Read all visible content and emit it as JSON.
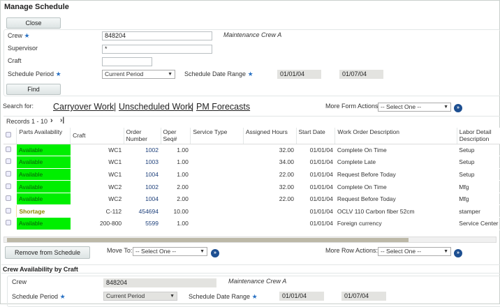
{
  "title": "Manage Schedule",
  "close_label": "Close",
  "find_label": "Find",
  "form": {
    "crew_label": "Crew",
    "crew_value": "848204",
    "crew_name": "Maintenance Crew A",
    "supervisor_label": "Supervisor",
    "supervisor_value": "*",
    "craft_label": "Craft",
    "craft_value": "",
    "period_label": "Schedule Period",
    "period_value": "Current Period",
    "range_label": "Schedule Date Range",
    "range_from": "01/01/04",
    "range_to": "01/07/04"
  },
  "search": {
    "label": "Search for:",
    "links": [
      "Carryover Work",
      "Unscheduled Work",
      "PM Forecasts"
    ],
    "sep": "|",
    "actions_label": "More Form Actions:",
    "actions_value": "-- Select One --"
  },
  "records": "Records 1 - 10",
  "columns": [
    "Parts Availability",
    "Craft",
    "Order Number",
    "Oper Seq#",
    "Service Type",
    "Assigned Hours",
    "Start Date",
    "Work Order Description",
    "Labor Detail Description"
  ],
  "rows": [
    {
      "parts": "Available",
      "craft": "WC1",
      "order": "1002",
      "seq": "1.00",
      "service": "",
      "hours": "32.00",
      "start": "01/01/04",
      "desc": "Complete On Time",
      "labor": "Setup"
    },
    {
      "parts": "Available",
      "craft": "WC1",
      "order": "1003",
      "seq": "1.00",
      "service": "",
      "hours": "34.00",
      "start": "01/01/04",
      "desc": "Complete Late",
      "labor": "Setup"
    },
    {
      "parts": "Available",
      "craft": "WC1",
      "order": "1004",
      "seq": "1.00",
      "service": "",
      "hours": "22.00",
      "start": "01/01/04",
      "desc": "Request Before Today",
      "labor": "Setup"
    },
    {
      "parts": "Available",
      "craft": "WC2",
      "order": "1002",
      "seq": "2.00",
      "service": "",
      "hours": "32.00",
      "start": "01/01/04",
      "desc": "Complete On Time",
      "labor": "Mfg"
    },
    {
      "parts": "Available",
      "craft": "WC2",
      "order": "1004",
      "seq": "2.00",
      "service": "",
      "hours": "22.00",
      "start": "01/01/04",
      "desc": "Request Before Today",
      "labor": "Mfg"
    },
    {
      "parts": "Shortage",
      "craft": "C-112",
      "order": "454694",
      "seq": "10.00",
      "service": "",
      "hours": "",
      "start": "01/01/04",
      "desc": "OCLV 110 Carbon fiber 52cm",
      "labor": "stamper"
    },
    {
      "parts": "Available",
      "craft": "200-800",
      "order": "5599",
      "seq": "1.00",
      "service": "",
      "hours": "",
      "start": "01/01/04",
      "desc": "Foreign currency",
      "labor": "Service Center"
    }
  ],
  "bottom": {
    "remove_label": "Remove from Schedule",
    "move_label": "Move To:",
    "move_value": "-- Select One --",
    "row_actions_label": "More Row Actions:",
    "row_actions_value": "-- Select One --"
  },
  "crew_avail": {
    "title": "Crew Availability by Craft",
    "crew_label": "Crew",
    "crew_value": "848204",
    "crew_name": "Maintenance Crew A",
    "period_label": "Schedule Period",
    "period_value": "Current Period",
    "range_label": "Schedule Date Range",
    "range_from": "01/01/04",
    "range_to": "01/07/04"
  },
  "colors": {
    "available": "#00ef00",
    "go": "#1d4f91",
    "star": "#2a72c4"
  }
}
